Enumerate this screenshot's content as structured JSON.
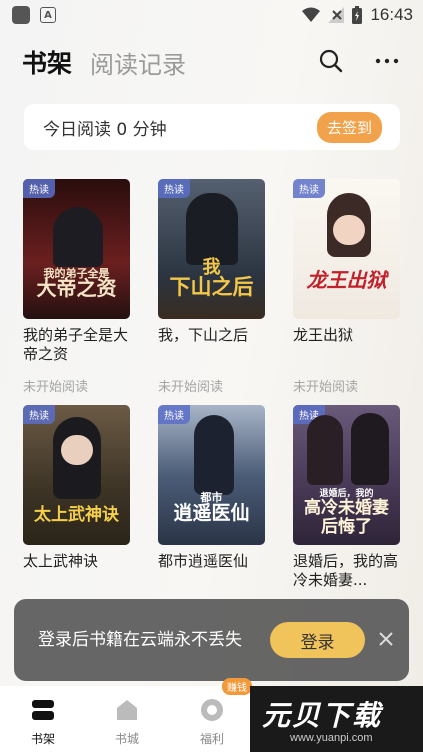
{
  "status_bar": {
    "time": "16:43",
    "a_label": "A"
  },
  "header": {
    "tab_bookshelf": "书架",
    "tab_history": "阅读记录"
  },
  "reading": {
    "text": "今日阅读 0 分钟",
    "checkin_label": "去签到"
  },
  "badge_label": "热读",
  "books": [
    {
      "title": "我的弟子全是大帝之资",
      "cover_text": "大帝之资",
      "cover_sub": "我的弟子全是",
      "status": "未开始阅读",
      "cover_bg": "#4a1818",
      "cover_fg": "#f5e6c8"
    },
    {
      "title": "我，下山之后",
      "cover_text": "下山之后",
      "cover_sub": "我",
      "status": "未开始阅读",
      "cover_bg": "#2e3a48",
      "cover_fg": "#f3c74a"
    },
    {
      "title": "龙王出狱",
      "cover_text": "龙王出狱",
      "cover_sub": "",
      "status": "未开始阅读",
      "cover_bg": "#f2efe9",
      "cover_fg": "#c2202a"
    },
    {
      "title": "太上武神诀",
      "cover_text": "太上武神诀",
      "cover_sub": "",
      "status": "",
      "cover_bg": "#3d3426",
      "cover_fg": "#f5cf4a"
    },
    {
      "title": "都市逍遥医仙",
      "cover_text": "逍遥医仙",
      "cover_sub": "都市",
      "status": "",
      "cover_bg": "#2f3e55",
      "cover_fg": "#ffffff"
    },
    {
      "title": "退婚后，我的高冷未婚妻...",
      "cover_text": "高冷未婚妻后悔了",
      "cover_sub": "退婚后，我的",
      "status": "",
      "cover_bg": "#4d3d5c",
      "cover_fg": "#fff3d8"
    }
  ],
  "toast": {
    "text": "登录后书籍在云端永不丢失",
    "login_label": "登录"
  },
  "nav": {
    "bookshelf": "书架",
    "bookstore": "书城",
    "welfare": "福利",
    "earn_badge": "赚钱"
  },
  "watermark": {
    "main": "元贝下载",
    "sub": "www.yuanpi.com"
  }
}
